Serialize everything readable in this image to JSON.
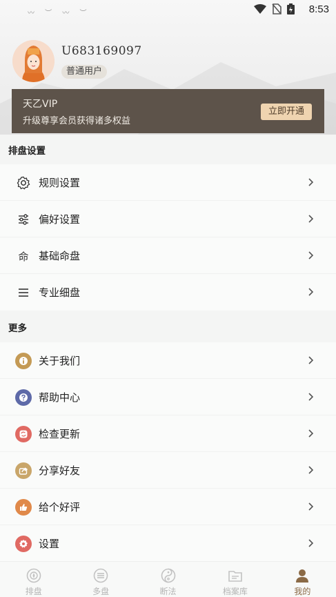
{
  "status_bar": {
    "time": "8:53"
  },
  "profile": {
    "username": "U683169097",
    "badge": "普通用户"
  },
  "vip": {
    "title": "天乙VIP",
    "subtitle": "升级尊享会员获得诸多权益",
    "button": "立即开通"
  },
  "sections": {
    "paipan": {
      "title": "排盘设置",
      "items": [
        {
          "label": "规则设置",
          "icon": "gear-icon"
        },
        {
          "label": "偏好设置",
          "icon": "sliders-icon"
        },
        {
          "label": "基础命盘",
          "icon": "ming-char-icon",
          "icon_text": "命"
        },
        {
          "label": "专业细盘",
          "icon": "menu-lines-icon"
        }
      ]
    },
    "more": {
      "title": "更多",
      "items": [
        {
          "label": "关于我们",
          "icon": "info-icon",
          "color": "#c49a55"
        },
        {
          "label": "帮助中心",
          "icon": "help-icon",
          "color": "#5e6aa8"
        },
        {
          "label": "检查更新",
          "icon": "refresh-icon",
          "color": "#e06a63"
        },
        {
          "label": "分享好友",
          "icon": "share-icon",
          "color": "#c9a66a"
        },
        {
          "label": "给个好评",
          "icon": "thumbs-up-icon",
          "color": "#e0894a"
        },
        {
          "label": "设置",
          "icon": "settings-icon",
          "color": "#e06a63"
        }
      ]
    }
  },
  "tabs": [
    {
      "label": "排盘",
      "icon": "compass-icon",
      "active": false
    },
    {
      "label": "多盘",
      "icon": "stack-icon",
      "active": false
    },
    {
      "label": "断法",
      "icon": "yin-yang-icon",
      "active": false
    },
    {
      "label": "档案库",
      "icon": "folder-icon",
      "active": false
    },
    {
      "label": "我的",
      "icon": "user-icon",
      "active": true
    }
  ],
  "colors": {
    "accent": "#8b6a46",
    "vip_bg": "#5d534a",
    "vip_button": "#efd4b0"
  }
}
